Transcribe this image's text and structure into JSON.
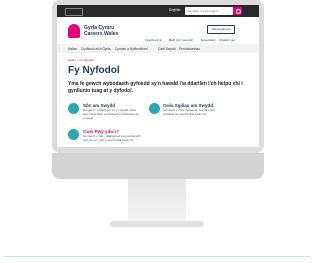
{
  "topbar": {
    "language": "English",
    "search_placeholder": "Sut allwn ni eich helpu?"
  },
  "header": {
    "brand_line1": "Gyrfa Cymru",
    "brand_line2": "Careers Wales",
    "account_button": "Mewngofnodi",
    "links": [
      "Cysylltu â ni",
      "Beth yw'r newydd",
      "Newyddion",
      "Chwilio'r we"
    ]
  },
  "nav": {
    "items": [
      "Hafan",
      "Cynllunio eich Gyrfa",
      "Cyrsiau a Hyfforddiant",
      "Cael Swydd",
      "Prentisiaethau"
    ]
  },
  "breadcrumb": "Hafan > Fy Nyfodol",
  "page_title": "Fy Nyfodol",
  "intro": "Yma fe gewch wybodaeth gyfoedd sy'n hawdd i'w ddarllen i'ch helpu chi i gynllunio tuag at y dyfodol.",
  "cards": [
    {
      "title": "Sôn am Swydd",
      "text": "Dysgwch i rywbeth am un o'r swyddi mewn byw, hefyd fideo prentisiaeth a chofnodau am y swydd.",
      "color": "#1e3a63"
    },
    {
      "title": "Cwis Sgiliau am Swydd",
      "text": "Gwnewch y Cwis Sgiliau am Swydd i gael syniadau am swyddi allai siwtio chi.",
      "color": "#1e3a63"
    },
    {
      "title": "Cwis Pwy ydw i?",
      "text": "Gwnewch y cwis i ddarganfod mwy amdanoch eich hun a'r math o swydd allai siwtio chi.",
      "color": "#e4007d"
    }
  ],
  "colors": {
    "brand_pink": "#e4007d",
    "brand_navy": "#1e3a63",
    "icon_teal": "#2aa7b3"
  }
}
